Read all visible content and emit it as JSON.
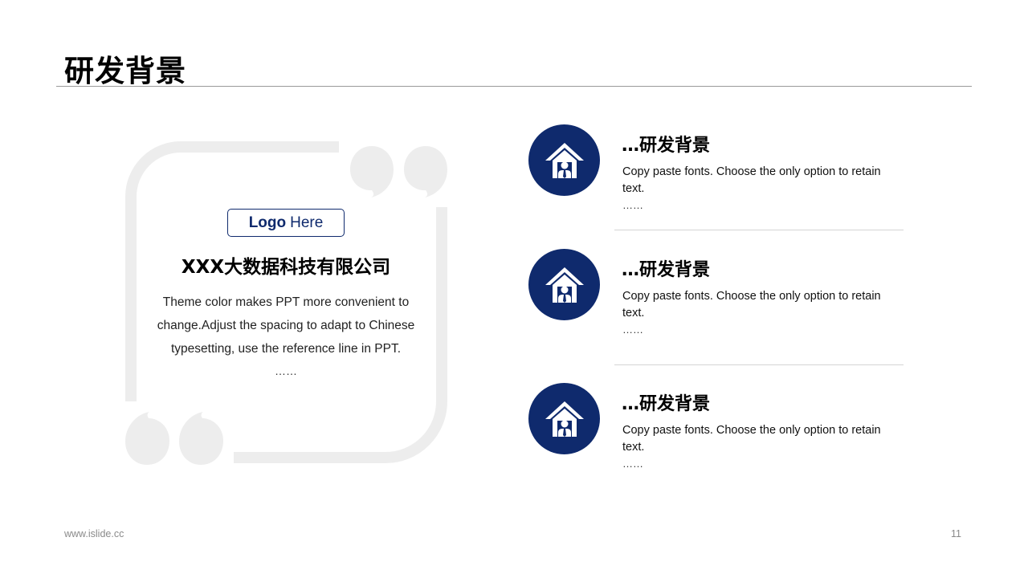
{
  "page": {
    "title": "研发背景",
    "footer_url": "www.islide.cc",
    "page_number": "11"
  },
  "left_card": {
    "logo_bold": "Logo",
    "logo_rest": "Here",
    "company": "XXX大数据科技有限公司",
    "description": "Theme color makes PPT more convenient to change.Adjust the spacing to adapt to Chinese typesetting, use the reference line in PPT.",
    "ellipsis": "……"
  },
  "items": [
    {
      "title": "…研发背景",
      "text": "Copy paste fonts. Choose the only option to retain text.",
      "ellipsis": "……",
      "icon": "house-person-icon"
    },
    {
      "title": "…研发背景",
      "text": "Copy paste fonts. Choose the only option to retain text.",
      "ellipsis": "……",
      "icon": "house-person-icon"
    },
    {
      "title": "…研发背景",
      "text": "Copy paste fonts. Choose the only option to retain text.",
      "ellipsis": "……",
      "icon": "house-person-icon"
    }
  ],
  "colors": {
    "accent": "#0f2a6d",
    "decoration": "#ededed",
    "rule": "#9a9a9a"
  }
}
